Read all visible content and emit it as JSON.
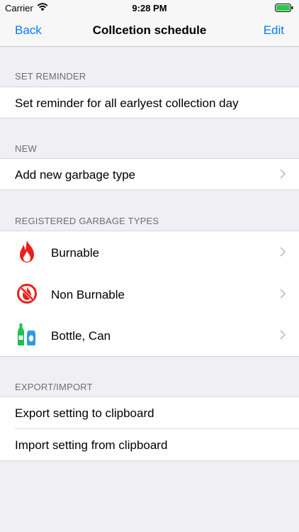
{
  "status_bar": {
    "carrier": "Carrier",
    "time": "9:28 PM"
  },
  "nav": {
    "back": "Back",
    "title": "Collcetion schedule",
    "edit": "Edit"
  },
  "sections": {
    "reminder": {
      "header": "SET REMINDER",
      "row": "Set reminder for all earlyest collection day"
    },
    "new": {
      "header": "NEW",
      "row": "Add new garbage type"
    },
    "registered": {
      "header": "REGISTERED GARBAGE TYPES",
      "items": [
        {
          "label": "Burnable",
          "icon": "flame-icon",
          "color": "#e8201a"
        },
        {
          "label": "Non Burnable",
          "icon": "no-fire-icon",
          "color": "#e8201a"
        },
        {
          "label": "Bottle, Can",
          "icon": "bottle-can-icon",
          "color": "#1fbf55"
        }
      ]
    },
    "export": {
      "header": "EXPORT/IMPORT",
      "rows": [
        "Export setting to clipboard",
        "Import setting from clipboard"
      ]
    }
  },
  "colors": {
    "accent": "#0a7aff",
    "background": "#efeff4",
    "header_text": "#6d6d72"
  }
}
